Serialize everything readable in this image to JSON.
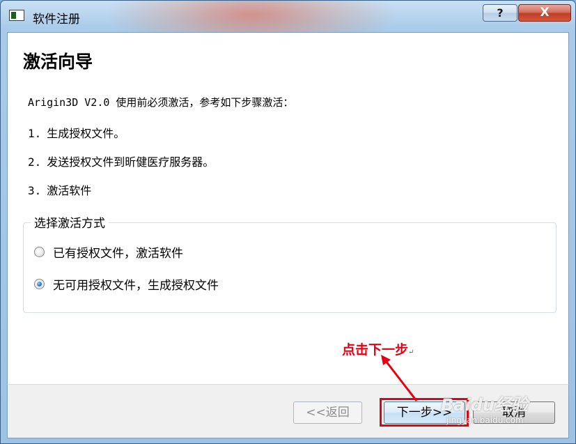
{
  "window": {
    "title": "软件注册",
    "help_label": "?",
    "close_label": "X"
  },
  "content": {
    "heading": "激活向导",
    "intro": "Arigin3D V2.0 使用前必须激活，参考如下步骤激活：",
    "steps": [
      {
        "num": "1.",
        "text": "生成授权文件。"
      },
      {
        "num": "2.",
        "text": "发送授权文件到昕健医疗服务器。"
      },
      {
        "num": "3.",
        "text": "激活软件"
      }
    ],
    "group": {
      "legend": "选择激活方式",
      "options": [
        {
          "label": "已有授权文件，激活软件",
          "checked": false
        },
        {
          "label": "无可用授权文件，生成授权文件",
          "checked": true
        }
      ]
    }
  },
  "footer": {
    "back_label": "<<返回",
    "next_label": "下一步>>",
    "cancel_label": "取消"
  },
  "annotation": {
    "text": "点击下一步",
    "mark": "↵",
    "color": "#e60012"
  },
  "watermark": {
    "brand": "Baidu经验",
    "url": "jingyan.baidu.com"
  }
}
